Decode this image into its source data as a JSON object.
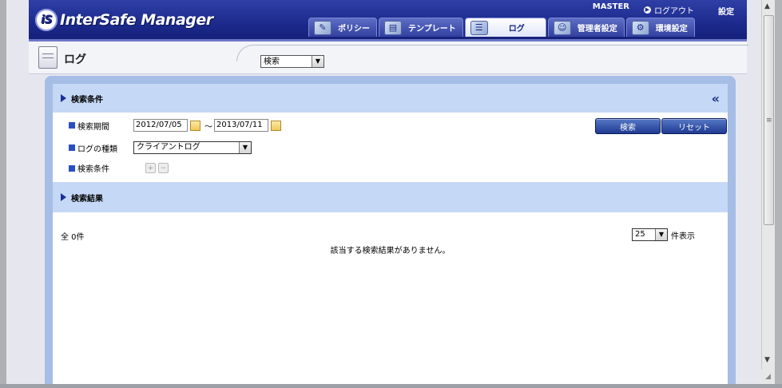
{
  "header": {
    "app_title": "InterSafe Manager",
    "logo_mark": "iS",
    "user_name": "MASTER",
    "logout_label": "ログアウト",
    "settings_label": "設定",
    "tabs": [
      {
        "label": "ポリシー",
        "icon": "policy-icon",
        "active": false
      },
      {
        "label": "テンプレート",
        "icon": "template-icon",
        "active": false
      },
      {
        "label": "ログ",
        "icon": "log-icon",
        "active": true
      },
      {
        "label": "管理者設定",
        "icon": "admin-icon",
        "active": false
      },
      {
        "label": "環境設定",
        "icon": "environment-icon",
        "active": false
      }
    ]
  },
  "page": {
    "title": "ログ",
    "mode_select_value": "検索"
  },
  "search": {
    "section_title": "検索条件",
    "collapse_glyph": "«",
    "period_label": "検索期間",
    "date_from": "2012/07/05",
    "tilde": "〜",
    "date_to": "2013/07/11",
    "log_type_label": "ログの種類",
    "log_type_value": "クライアントログ",
    "condition_label": "検索条件",
    "search_button": "検索",
    "reset_button": "リセット"
  },
  "results": {
    "section_title": "検索結果",
    "total_count": "全 0件",
    "no_result_message": "該当する検索結果がありません。",
    "per_page_value": "25",
    "per_page_label": "件表示"
  },
  "colors": {
    "header_blue": "#1c2a8c",
    "panel_blue": "#a6bde6",
    "section_head": "#c5d9f6"
  }
}
